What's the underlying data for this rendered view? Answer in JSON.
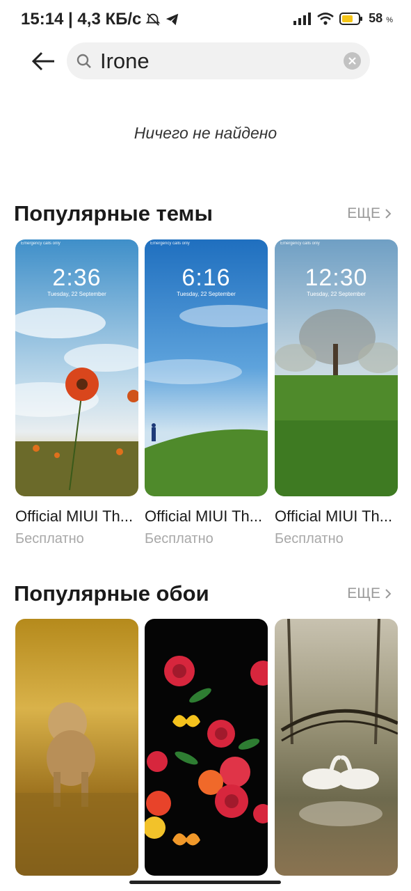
{
  "status_bar": {
    "time_speed": "15:14 | 4,3 КБ/с",
    "battery_percent": "58",
    "battery_unit": "%",
    "icons": [
      "alarm-off-icon",
      "telegram-icon",
      "signal-icon",
      "wifi-icon",
      "battery-icon"
    ]
  },
  "search": {
    "value": "Irone",
    "placeholder": ""
  },
  "empty_message": "Ничего не найдено",
  "themes_section": {
    "title": "Популярные темы",
    "more_label": "ЕЩЕ",
    "items": [
      {
        "title": "Official MIUI Th...",
        "price": "Бесплатно",
        "lock_time": "2:36",
        "lock_date": "Tuesday, 22 September"
      },
      {
        "title": "Official MIUI Th...",
        "price": "Бесплатно",
        "lock_time": "6:16",
        "lock_date": "Tuesday, 22 September"
      },
      {
        "title": "Official MIUI Th...",
        "price": "Бесплатно",
        "lock_time": "12:30",
        "lock_date": "Tuesday, 22 September"
      }
    ]
  },
  "wallpapers_section": {
    "title": "Популярные обои",
    "more_label": "ЕЩЕ",
    "items": [
      "lioness-wallpaper",
      "roses-wallpaper",
      "swans-wallpaper"
    ]
  },
  "colors": {
    "accent": "#f5c518",
    "muted_text": "#a8a8a8"
  }
}
